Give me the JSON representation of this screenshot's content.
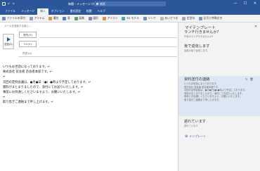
{
  "titlebar": {
    "title": "無題 - メッセージ (HTML 形式)",
    "search_placeholder": "検索",
    "minimize": "—",
    "maximize": "☐",
    "close": "✕"
  },
  "menu": {
    "tabs": [
      "ファイル",
      "メッセージ",
      "挿入",
      "オプション",
      "書式設定",
      "校閲",
      "ヘルプ"
    ],
    "active_index": 2
  },
  "ribbon": {
    "items": [
      "ファイルの添付",
      "アイテム",
      "署名",
      "表",
      "画像",
      "図形",
      "アイコン",
      "3D モデル",
      "リンク",
      "あいさつ文",
      "定型句",
      "記号と特殊文字"
    ]
  },
  "infobar": {
    "text": "メールを送信する前に…"
  },
  "compose": {
    "send_label": "送信(S)",
    "to_label": "宛先(T)",
    "cc_label": "CC(C)",
    "subject_label": "件名(U)"
  },
  "body": {
    "lines": [
      "いつもお世話になっております。↵",
      "株式会社 苗会者 苗会者本部です。↵",
      "↵",
      "次回の定例会議は、●月●日（●）●時より予定しております。↵",
      "資料がまとまりましたので、添付にてお送りいたします。↵",
      "事前にお目通しくださいますよう、お願いいたします。↵",
      "↵",
      "取り急ぎご連絡まで申し上げます。↵"
    ]
  },
  "panel": {
    "title": "マイテンプレート",
    "close": "✕",
    "templates": [
      {
        "title": "ランチ行きませんか?",
        "desc": "午後のランチ行きませんか?"
      },
      {
        "title": "後で返信します",
        "desc": "会議の後で返信します。"
      },
      {
        "title": "資料送付の連絡",
        "desc": "いつもお世話になっております。"
      },
      {
        "title": "遅れています",
        "desc": "遅れています"
      }
    ],
    "active_body": [
      "いつもお世話になっております。",
      "株式会社 苗会者 苗会者本部です。",
      "次回の定例会議は、●月●日(●)●時より予定しております。",
      "資料がまとまりましたので、添付にてお送りいたします。",
      "事前にお目通しくださいますよう、お願いいたします。",
      "取り急ぎご連絡まで申し上げます。"
    ],
    "add_label": "テンプレート"
  }
}
